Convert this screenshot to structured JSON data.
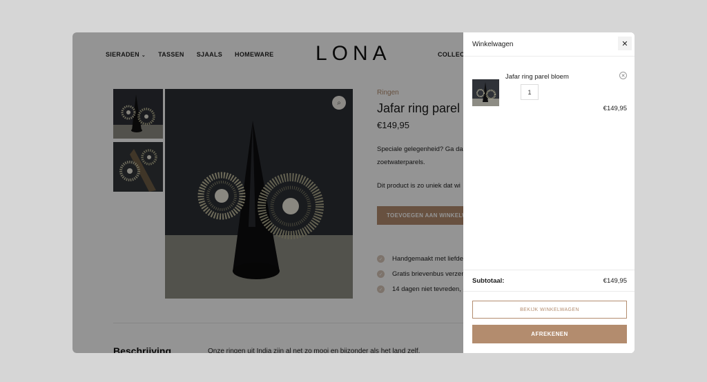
{
  "nav": {
    "items": [
      "SIERADEN",
      "TASSEN",
      "SJAALS",
      "HOMEWARE"
    ],
    "collections_partial": "COLLECT",
    "logo": "LONA"
  },
  "product": {
    "category": "Ringen",
    "title": "Jafar ring parel",
    "price": "€149,95",
    "desc_line1": "Speciale gelegenheid? Ga da",
    "desc_line2": "zoetwaterparels.",
    "desc_line3": "Dit product is zo uniek dat wi",
    "add_to_cart": "TOEVOEGEN AAN WINKELWA",
    "features": [
      "Handgemaakt met liefde",
      "Gratis brievenbus verzen",
      "14 dagen niet tevreden, g"
    ],
    "description_heading": "Beschrijving",
    "description_text": "Onze ringen uit India zijn al net zo mooi en bijzonder als het land zelf."
  },
  "cart": {
    "title": "Winkelwagen",
    "item_name": "Jafar ring parel bloem",
    "item_qty": "1",
    "item_price": "€149,95",
    "subtotal_label": "Subtotaal:",
    "subtotal_value": "€149,95",
    "view_cart": "BEKIJK WINKELWAGEN",
    "checkout": "AFREKENEN"
  },
  "icons": {
    "close": "close-icon",
    "zoom": "zoom-icon",
    "remove": "remove-icon",
    "check": "check-icon",
    "chevron": "chevron-down-icon"
  },
  "colors": {
    "accent": "#b38c6e",
    "overlay": "rgba(0,0,0,0.42)"
  }
}
